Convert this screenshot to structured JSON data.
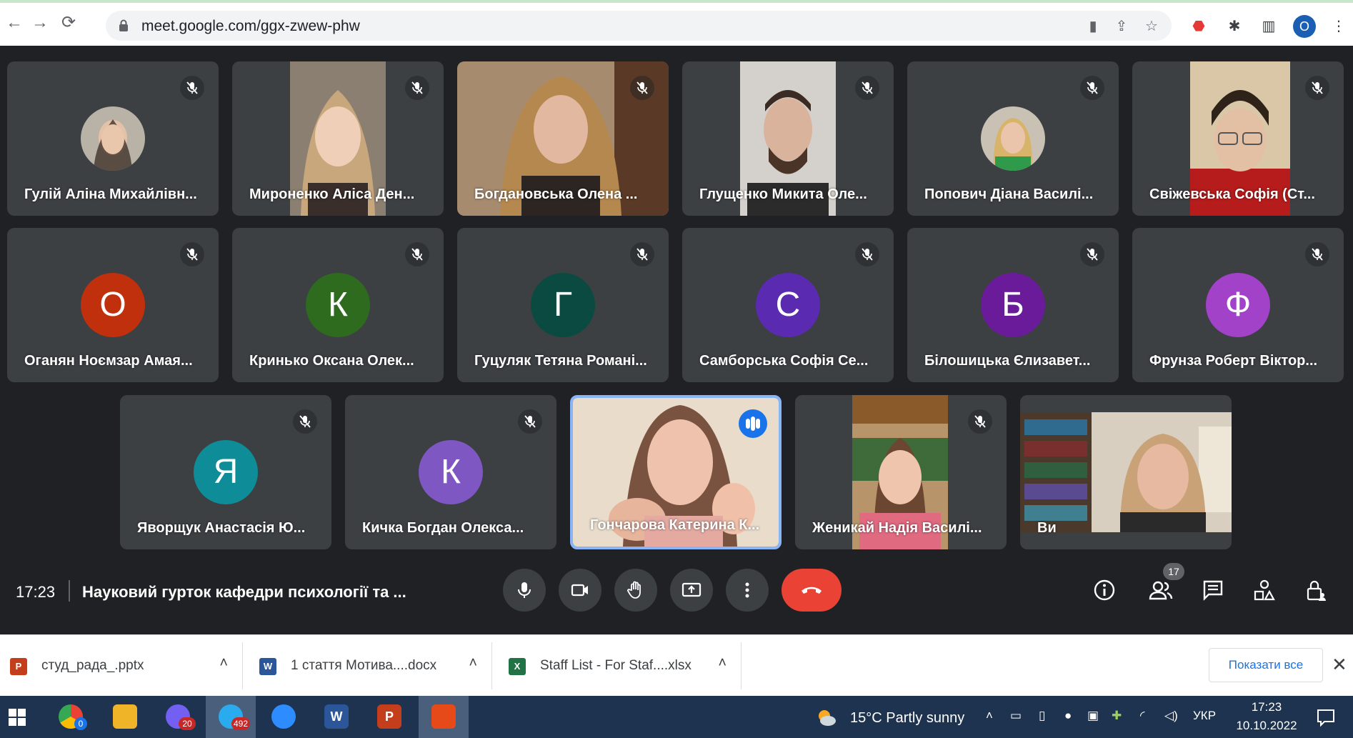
{
  "browser": {
    "url": "meet.google.com/ggx-zwew-phw",
    "profile_initial": "O"
  },
  "tiles_row1": [
    {
      "name": "Гулій Аліна Михайлівн..."
    },
    {
      "name": "Мироненко Аліса Ден..."
    },
    {
      "name": "Богдановська Олена ..."
    },
    {
      "name": "Глущенко Микита Оле..."
    },
    {
      "name": "Попович Діана Василі..."
    },
    {
      "name": "Свіжевська Софія (Ст..."
    }
  ],
  "tiles_row2": [
    {
      "name": "Оганян Ноємзар Амая...",
      "initial": "О",
      "color": "#c1300c"
    },
    {
      "name": "Кринько Оксана Олек...",
      "initial": "К",
      "color": "#2e6b1f"
    },
    {
      "name": "Гуцуляк Тетяна Романі...",
      "initial": "Г",
      "color": "#0b4a40"
    },
    {
      "name": "Самборська Софія Се...",
      "initial": "С",
      "color": "#5a2ab0"
    },
    {
      "name": "Білошицька Єлизавет...",
      "initial": "Б",
      "color": "#6a1b9a"
    },
    {
      "name": "Фрунза Роберт Віктор...",
      "initial": "Ф",
      "color": "#a142c9"
    }
  ],
  "tiles_row3": [
    {
      "name": "Яворщук Анастасія Ю...",
      "initial": "Я",
      "color": "#0e8c97"
    },
    {
      "name": "Кичка Богдан Олекса...",
      "initial": "К",
      "color": "#7e57c2"
    },
    {
      "name": "Гончарова Катерина К..."
    },
    {
      "name": "Женикай Надія Василі..."
    },
    {
      "name": "Ви"
    }
  ],
  "meet_bar": {
    "time": "17:23",
    "title": "Науковий гурток кафедри психології та ...",
    "participants_count": "17"
  },
  "downloads": [
    {
      "name": "студ_рада_.pptx",
      "icon": "powerpoint-icon",
      "color": "#c43e1c",
      "letter": "P"
    },
    {
      "name": "1 стаття Мотива....docx",
      "icon": "word-icon",
      "color": "#2b579a",
      "letter": "W"
    },
    {
      "name": "Staff List - For Staf....xlsx",
      "icon": "excel-icon",
      "color": "#217346",
      "letter": "X"
    }
  ],
  "downloads_show_all": "Показати все",
  "taskbar": {
    "viber_badge": "20",
    "telegram_badge": "492",
    "chrome_badge": "0",
    "weather": "15°C  Partly sunny",
    "language": "УКР",
    "time": "17:23",
    "date": "10.10.2022"
  }
}
